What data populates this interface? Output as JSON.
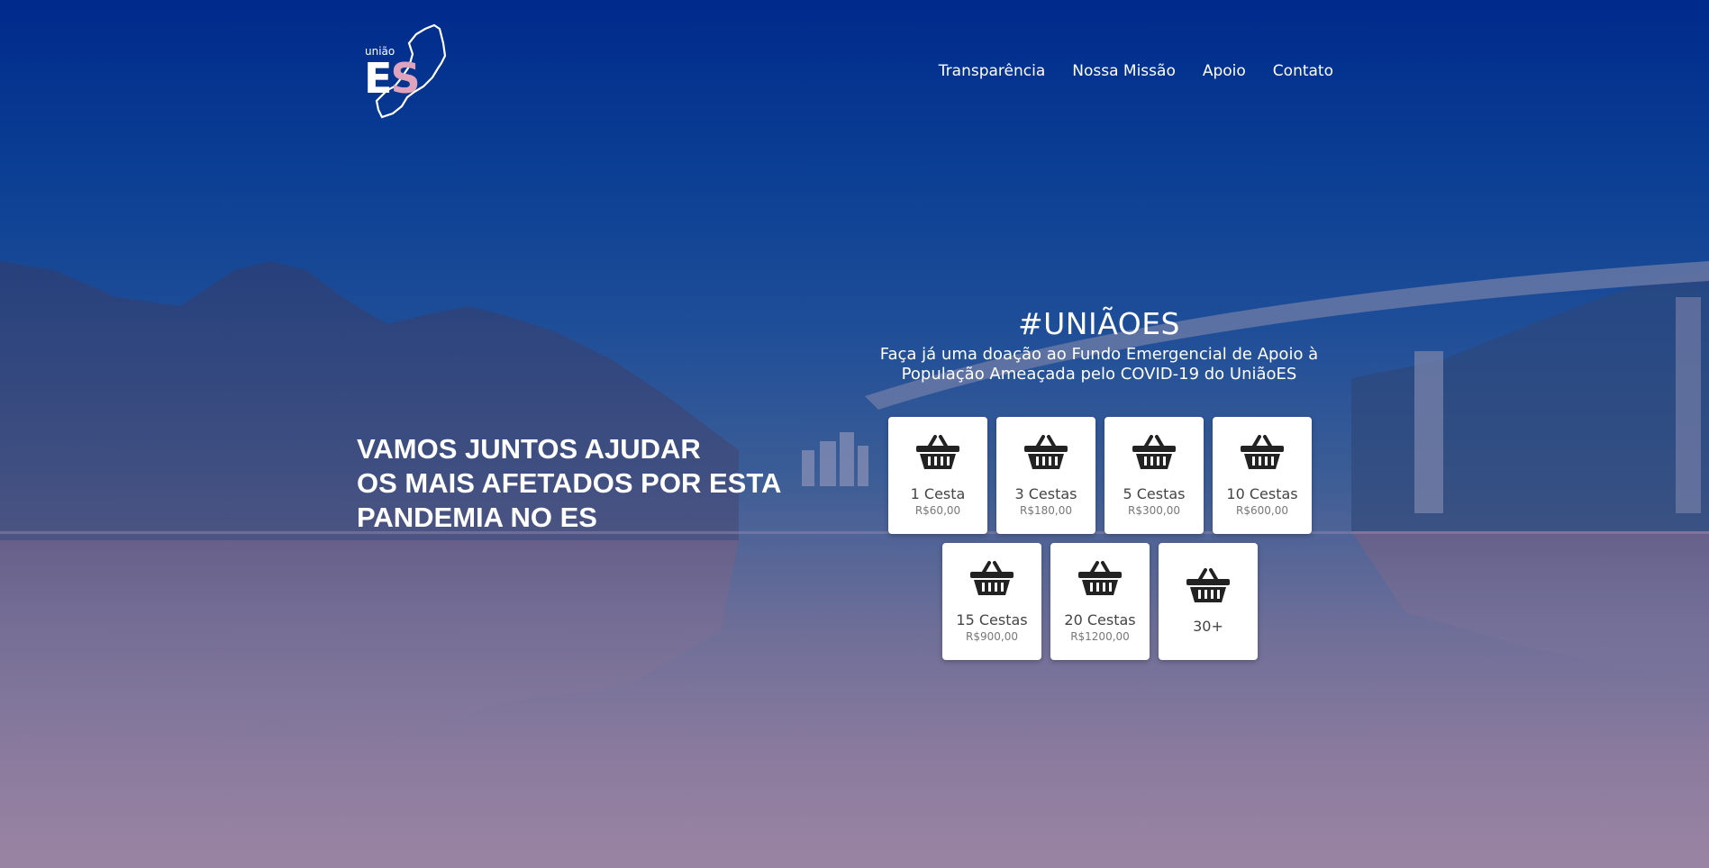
{
  "brand": {
    "small_text": "união",
    "letters_e": "E",
    "letters_s": "S"
  },
  "nav": {
    "items": [
      {
        "label": "Transparência"
      },
      {
        "label": "Nossa Missão"
      },
      {
        "label": "Apoio"
      },
      {
        "label": "Contato"
      }
    ]
  },
  "hero": {
    "line1": "VAMOS JUNTOS AJUDAR",
    "line2": "OS MAIS AFETADOS POR ESTA",
    "line3": "PANDEMIA NO ES"
  },
  "donation": {
    "title": "#UNIÃOES",
    "subtitle_line1": "Faça já uma doação ao Fundo Emergencial de Apoio à",
    "subtitle_line2": "População Ameaçada pelo COVID-19 do UniãoES",
    "options": [
      {
        "qty": "1 Cesta",
        "price": "R$60,00",
        "icon": "basket-icon"
      },
      {
        "qty": "3 Cestas",
        "price": "R$180,00",
        "icon": "basket-icon"
      },
      {
        "qty": "5 Cestas",
        "price": "R$300,00",
        "icon": "basket-icon"
      },
      {
        "qty": "10 Cestas",
        "price": "R$600,00",
        "icon": "basket-icon"
      },
      {
        "qty": "15 Cestas",
        "price": "R$900,00",
        "icon": "basket-icon"
      },
      {
        "qty": "20 Cestas",
        "price": "R$1200,00",
        "icon": "basket-icon"
      },
      {
        "qty": "30+",
        "price": "",
        "icon": "basket-icon"
      }
    ]
  },
  "colors": {
    "accent_pink": "#e0a3bd",
    "top_blue": "#002a8c"
  }
}
